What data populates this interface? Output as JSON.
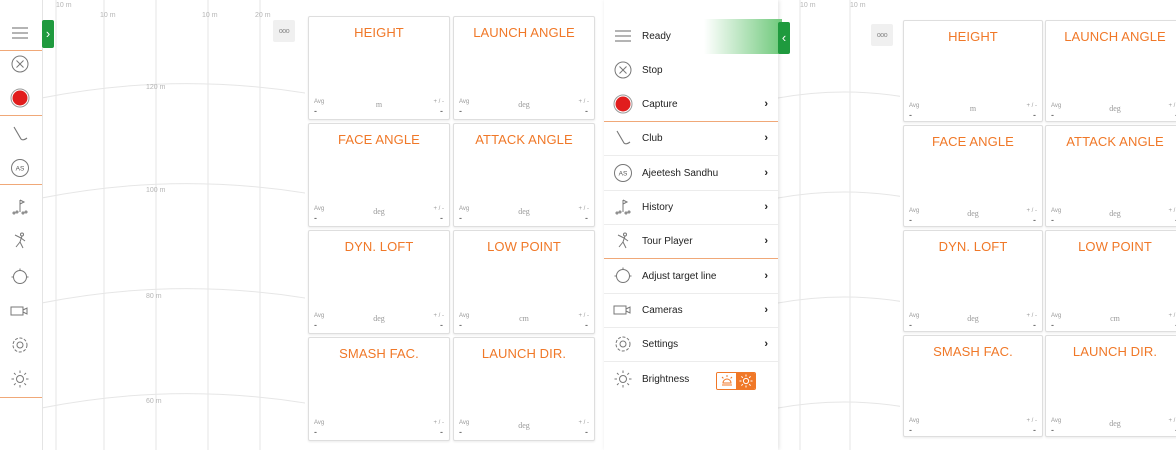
{
  "range_left": {
    "top_labels": [
      "10 m",
      "10 m",
      "10 m",
      "20 m"
    ],
    "distance_labels": [
      "120 m",
      "100 m",
      "80 m",
      "60 m"
    ]
  },
  "range_mid": {
    "top_labels": [
      "10 m",
      "10 m"
    ]
  },
  "toolbar": {
    "icons": [
      "hamburger-icon",
      "stop-icon",
      "record-icon",
      "club-icon",
      "avatar-icon",
      "history-icon",
      "tour-player-icon",
      "target-icon",
      "camera-icon",
      "settings-icon",
      "brightness-icon"
    ],
    "record_color": "#e11d1d",
    "separator_color": "#f0a878",
    "collapse_tab_glyph": "›"
  },
  "panel": {
    "more_glyph": "ooo",
    "avg_label": "Avg",
    "pm_label": "+ / -",
    "empty_value": "-",
    "tiles": [
      {
        "title": "HEIGHT",
        "unit": "m"
      },
      {
        "title": "LAUNCH ANGLE",
        "unit": "deg"
      },
      {
        "title": "FACE ANGLE",
        "unit": "deg"
      },
      {
        "title": "ATTACK ANGLE",
        "unit": "deg"
      },
      {
        "title": "DYN. LOFT",
        "unit": "deg"
      },
      {
        "title": "LOW POINT",
        "unit": "cm"
      },
      {
        "title": "SMASH FAC.",
        "unit": ""
      },
      {
        "title": "LAUNCH DIR.",
        "unit": "deg"
      }
    ]
  },
  "menu": {
    "collapse_tab_glyph": "‹",
    "items": [
      {
        "label": "Ready",
        "icon": "hamburger-icon",
        "chevron": ""
      },
      {
        "label": "Stop",
        "icon": "stop-icon",
        "chevron": ""
      },
      {
        "label": "Capture",
        "icon": "record-icon",
        "chevron": "›"
      },
      {
        "label": "Club",
        "icon": "club-icon",
        "chevron": "›"
      },
      {
        "label": "Ajeetesh Sandhu",
        "icon": "avatar-icon",
        "chevron": "›"
      },
      {
        "label": "History",
        "icon": "history-icon",
        "chevron": "›"
      },
      {
        "label": "Tour Player",
        "icon": "tour-player-icon",
        "chevron": "›"
      },
      {
        "label": "Adjust target line",
        "icon": "target-icon",
        "chevron": "›"
      },
      {
        "label": "Cameras",
        "icon": "camera-icon",
        "chevron": "›"
      },
      {
        "label": "Settings",
        "icon": "settings-icon",
        "chevron": "›"
      },
      {
        "label": "Brightness",
        "icon": "brightness-icon",
        "chevron": ""
      }
    ],
    "avatar_initials": "AS",
    "ready_gradient_color": "#6fc97b",
    "accent": "#f07828"
  },
  "colors": {
    "accent": "#f07828",
    "tab_green": "#1f9a3e",
    "record_red": "#e11d1d"
  }
}
